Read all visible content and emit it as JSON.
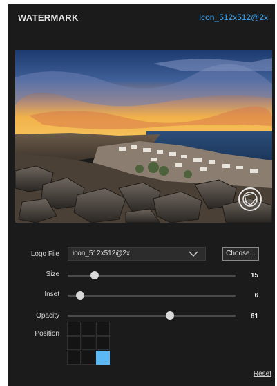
{
  "header": {
    "title": "WATERMARK",
    "logo_name": "icon_512x512@2x"
  },
  "controls": {
    "logo_file": {
      "label": "Logo File",
      "value": "icon_512x512@2x",
      "choose_label": "Choose..."
    },
    "size": {
      "label": "Size",
      "value": "15",
      "fraction": 0.16
    },
    "inset": {
      "label": "Inset",
      "value": "6",
      "fraction": 0.075
    },
    "opacity": {
      "label": "Opacity",
      "value": "61",
      "fraction": 0.61
    },
    "position": {
      "label": "Position",
      "selected": "bottom-right",
      "cells": [
        "top-left",
        "top-center",
        "top-right",
        "middle-left",
        "center",
        "middle-right",
        "bottom-left",
        "bottom-center",
        "bottom-right"
      ]
    },
    "reset_label": "Reset"
  },
  "colors": {
    "accent": "#3fa9f5",
    "panel_bg": "#1b1b1b",
    "selected_cell": "#5bb8f5"
  },
  "icons": {
    "watermark_preview": "aperture-icon",
    "dropdown": "chevron-down-icon"
  }
}
